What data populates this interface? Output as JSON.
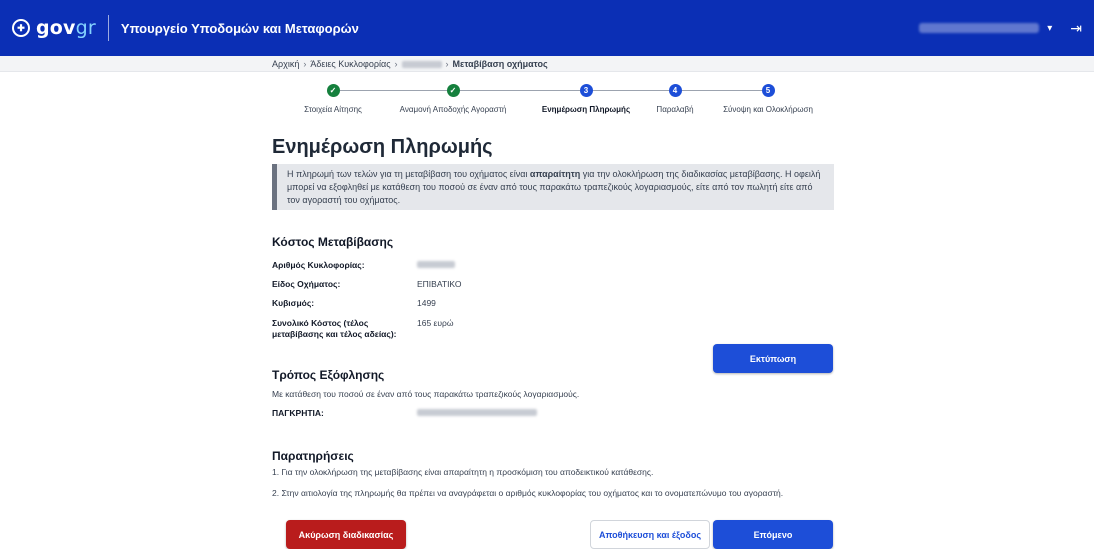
{
  "header": {
    "logo_prefix": "gov",
    "logo_suffix": "gr",
    "ministry": "Υπουργείο Υποδομών και Μεταφορών",
    "user_caret": "▾",
    "logout_icon": "⇥"
  },
  "breadcrumb": {
    "items": [
      "Αρχική",
      "Άδειες Κυκλοφορίας"
    ],
    "current": "Μεταβίβαση οχήματος",
    "separator": "›"
  },
  "stepper": {
    "steps": [
      {
        "label": "Στοιχεία Αίτησης",
        "mark": "✓",
        "state": "done"
      },
      {
        "label": "Αναμονή Αποδοχής Αγοραστή",
        "mark": "✓",
        "state": "done"
      },
      {
        "label": "Ενημέρωση Πληρωμής",
        "mark": "3",
        "state": "current"
      },
      {
        "label": "Παραλαβή",
        "mark": "4",
        "state": "pending"
      },
      {
        "label": "Σύνοψη και Ολοκλήρωση",
        "mark": "5",
        "state": "pending"
      }
    ]
  },
  "main": {
    "title": "Ενημέρωση Πληρωμής",
    "notice": {
      "before": "Η πληρωμή των τελών για τη μεταβίβαση του οχήματος είναι ",
      "bold": "απαραίτητη",
      "after": " για την ολοκλήρωση της διαδικασίας μεταβίβασης. Η οφειλή μπορεί να εξοφληθεί με κατάθεση του ποσού σε έναν από τους παρακάτω τραπεζικούς λογαριασμούς, είτε από τον πωλητή είτε από τον αγοραστή του οχήματος."
    },
    "cost": {
      "title": "Κόστος Μεταβίβασης",
      "rows": [
        {
          "key": "Αριθμός Κυκλοφορίας:",
          "value": ""
        },
        {
          "key": "Είδος Οχήματος:",
          "value": "ΕΠΙΒΑΤΙΚΟ"
        },
        {
          "key": "Κυβισμός:",
          "value": "1499"
        },
        {
          "key": "Συνολικό Κόστος (τέλος μεταβίβασης και τέλος αδείας):",
          "value": "165 ευρώ"
        }
      ]
    },
    "print_label": "Εκτύπωση",
    "payment": {
      "title": "Τρόπος Εξόφλησης",
      "text": "Με κατάθεση του ποσού σε έναν από τους παρακάτω τραπεζικούς λογαριασμούς.",
      "bank_key": "ΠΑΓΚΡΗΤΙΑ:"
    },
    "notes": {
      "title": "Παρατηρήσεις",
      "items": [
        "1. Για την ολοκλήρωση της μεταβίβασης είναι απαραίτητη η προσκόμιση του αποδεικτικού κατάθεσης.",
        "2. Στην αιτιολογία της πληρωμής θα πρέπει να αναγράφεται ο αριθμός κυκλοφορίας του οχήματος και το ονοματεπώνυμο του αγοραστή."
      ]
    },
    "buttons": {
      "cancel": "Ακύρωση διαδικασίας",
      "save_exit": "Αποθήκευση και έξοδος",
      "next": "Επόμενο"
    }
  },
  "colors": {
    "header": "#0b2fb5",
    "primary": "#1d4ed8",
    "danger": "#b91c1c",
    "done": "#15803d"
  }
}
